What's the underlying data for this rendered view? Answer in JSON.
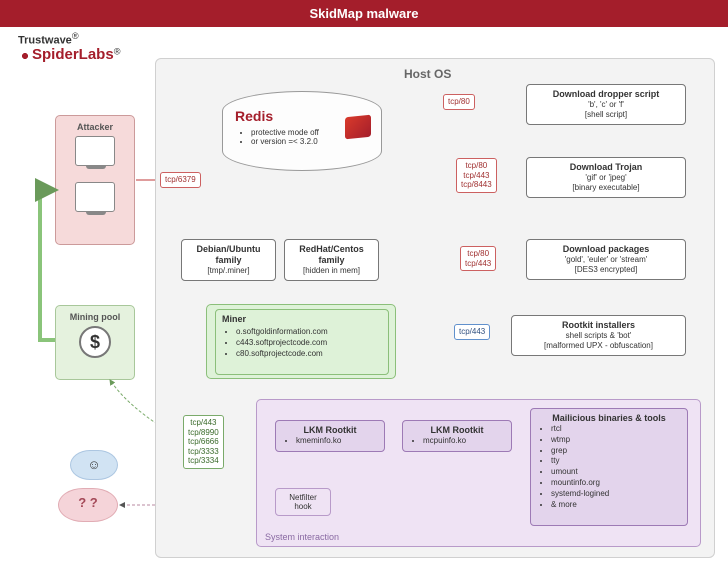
{
  "banner": "SkidMap malware",
  "logo": {
    "line1": "Trustwave",
    "sup1": "®",
    "line2": "SpiderLabs",
    "sup2": "®"
  },
  "host_label": "Host OS",
  "attacker": {
    "label": "Attacker"
  },
  "mining": {
    "label": "Mining pool",
    "symbol": "$"
  },
  "cloud_emoji": "☺",
  "cloud_q": "? ?",
  "redis": {
    "title": "Redis",
    "b1": "protective mode off",
    "b2": "or version =< 3.2.0"
  },
  "ports": {
    "p_redis": "tcp/6379",
    "p_drop": "tcp/80",
    "p_trojan": "tcp/80\ntcp/443\ntcp/8443",
    "p_pkg": "tcp/80\ntcp/443",
    "p_root": "tcp/443",
    "p_miner": "tcp/443\ntcp/8990\ntcp/6666\ntcp/3333\ntcp/3334"
  },
  "nodes": {
    "dropper": {
      "t": "Download dropper script",
      "s1": "'b', 'c' or 'f'",
      "s2": "[shell script]"
    },
    "trojan": {
      "t": "Download Trojan",
      "s1": "'gif' or 'jpeg'",
      "s2": "[binary executable]"
    },
    "deb": {
      "t": "Debian/Ubuntu",
      "t2": "family",
      "s": "[tmp/.miner]"
    },
    "rh": {
      "t": "RedHat/Centos",
      "t2": "family",
      "s": "[hidden in mem]"
    },
    "pkg": {
      "t": "Download packages",
      "s1": "'gold', 'euler' or 'stream'",
      "s2": "[DES3 encrypted]"
    },
    "rootkit": {
      "t": "Rootkit installers",
      "s1": "shell scripts & 'bot'",
      "s2": "[malformed UPX - obfuscation]"
    },
    "miner": {
      "t": "Miner",
      "b1": "o.softgoldinformation.com",
      "b2": "c443.softprojectcode.com",
      "b3": "c80.softprojectcode.com"
    },
    "lkm1": {
      "t": "LKM Rootkit",
      "b": "kmeminfo.ko"
    },
    "lkm2": {
      "t": "LKM Rootkit",
      "b": "mcpuinfo.ko"
    },
    "mal": {
      "t": "Mailicious binaries & tools",
      "b1": "rtcl",
      "b2": "wtmp",
      "b3": "grep",
      "b4": "tty",
      "b5": "umount",
      "b6": "mountinfo.org",
      "b7": "systemd-logined",
      "b8": "& more"
    },
    "nf": "Netfilter\nhook",
    "sys": "System interaction"
  }
}
